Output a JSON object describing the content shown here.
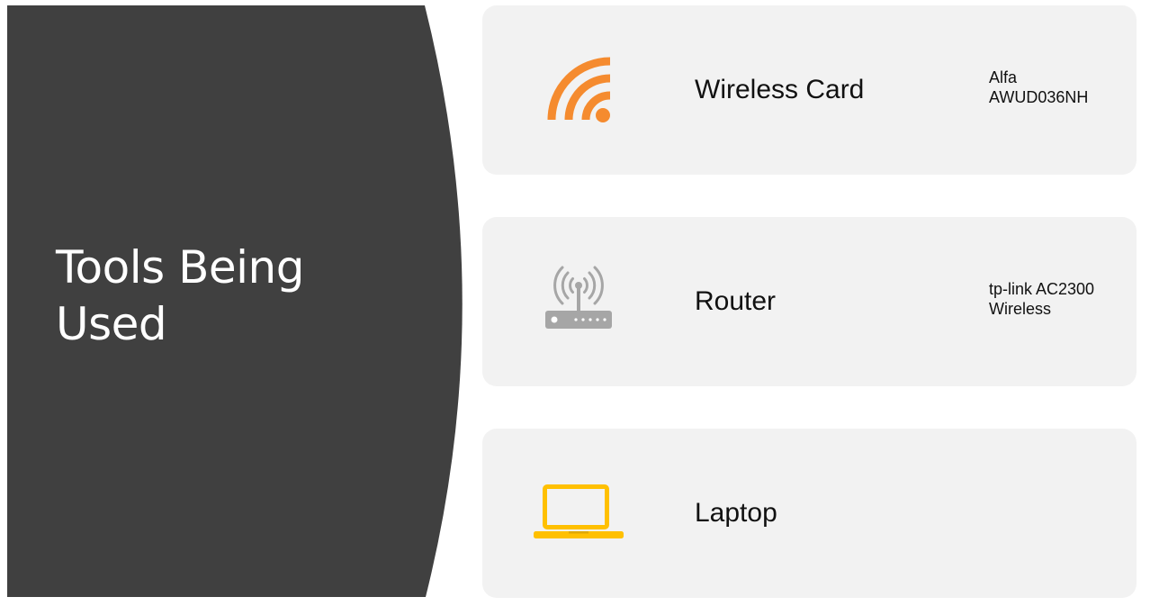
{
  "slide": {
    "title_line1": "Tools Being",
    "title_line2": "Used"
  },
  "items": [
    {
      "name": "Wireless Card",
      "detail_line1": "Alfa",
      "detail_line2": "AWUD036NH",
      "icon": "wifi-signal-icon",
      "icon_color": "#f58b2f"
    },
    {
      "name": "Router",
      "detail_line1": "tp-link AC2300",
      "detail_line2": "Wireless",
      "icon": "router-icon",
      "icon_color": "#a6a6a6"
    },
    {
      "name": "Laptop",
      "icon": "laptop-icon",
      "icon_color": "#ffc000"
    }
  ],
  "colors": {
    "panel": "#404040",
    "card": "#f2f2f2",
    "title": "#ffffff"
  }
}
